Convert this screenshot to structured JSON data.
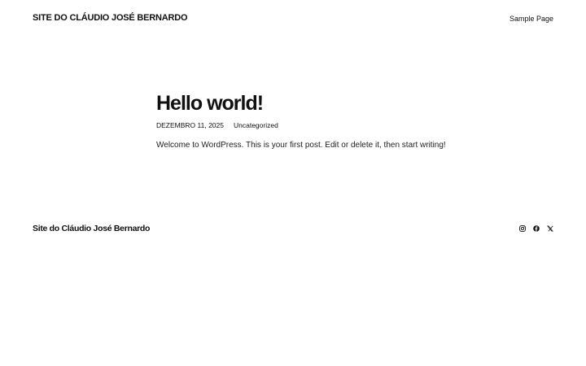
{
  "header": {
    "site_title": "SITE DO CLÁUDIO JOSÉ BERNARDO",
    "nav": [
      {
        "label": "Sample Page"
      }
    ]
  },
  "post": {
    "title": "Hello world!",
    "date": "DEZEMBRO 11, 2025",
    "category": "Uncategorized",
    "content": "Welcome to WordPress. This is your first post. Edit or delete it, then start writing!"
  },
  "footer": {
    "site_title": "Site do Cláudio José Bernardo",
    "social_icons": [
      "instagram-icon",
      "facebook-icon",
      "x-icon"
    ]
  },
  "colors": {
    "text": "#111111",
    "background": "#ffffff"
  }
}
